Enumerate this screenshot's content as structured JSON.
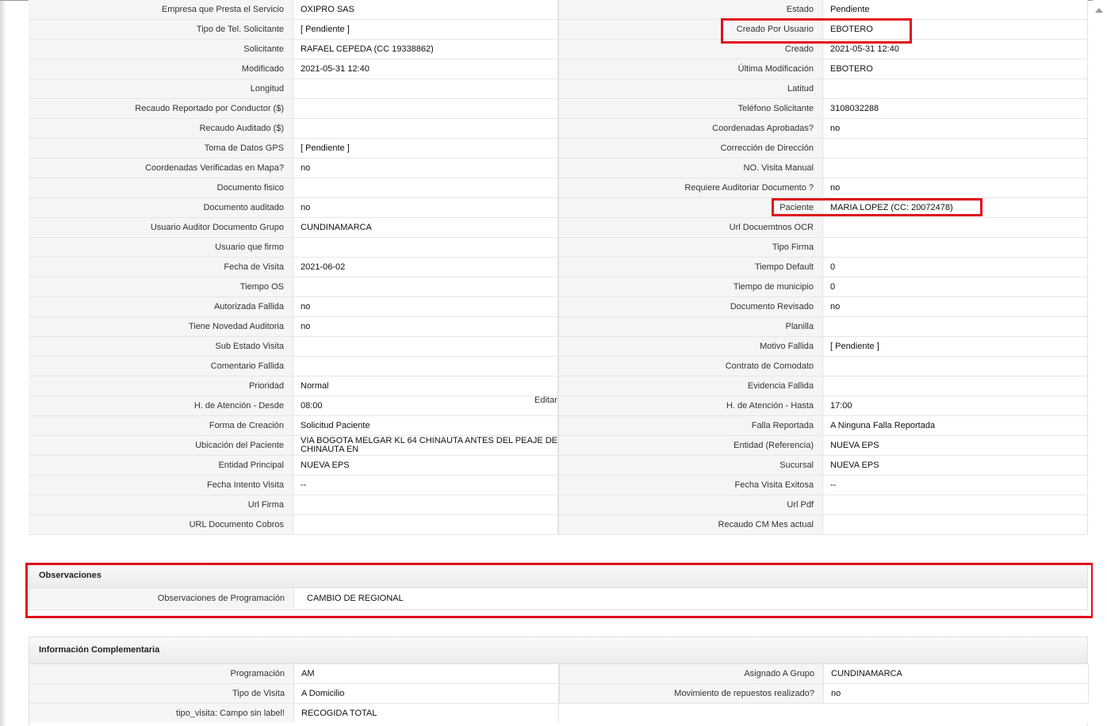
{
  "rows": [
    {
      "l1": "Empresa que Presta el Servicio",
      "v1": "OXIPRO SAS",
      "l2": "Estado",
      "v2": "Pendiente"
    },
    {
      "l1": "Tipo de Tel. Solicitante",
      "v1": "[ Pendiente ]",
      "l2": "Creado Por Usuario",
      "v2": "EBOTERO"
    },
    {
      "l1": "Solicitante",
      "v1": "RAFAEL CEPEDA (CC 19338862)",
      "l2": "Creado",
      "v2": "2021-05-31 12:40"
    },
    {
      "l1": "Modificado",
      "v1": "2021-05-31 12:40",
      "l2": "Última Modificación",
      "v2": " EBOTERO"
    },
    {
      "l1": "Longitud",
      "v1": "",
      "l2": "Latitud",
      "v2": ""
    },
    {
      "l1": "Recaudo Reportado por Conductor ($)",
      "v1": "",
      "l2": "Teléfono Solicitante",
      "v2": "3108032288"
    },
    {
      "l1": "Recaudo Auditado ($)",
      "v1": "",
      "l2": "Coordenadas Aprobadas?",
      "v2": " no"
    },
    {
      "l1": "Toma de Datos GPS",
      "v1": "[ Pendiente ]",
      "l2": "Corrección de Dirección",
      "v2": ""
    },
    {
      "l1": "Coordenadas Verificadas en Mapa?",
      "v1": " no",
      "l2": "NO. Visita Manual",
      "v2": ""
    },
    {
      "l1": "Documento fisico",
      "v1": "",
      "l2": "Requiere Auditoriar Documento ?",
      "v2": " no"
    },
    {
      "l1": "Documento auditado",
      "v1": " no",
      "l2": "Paciente",
      "v2": "MARIA LOPEZ (CC: 20072478)"
    },
    {
      "l1": "Usuario Auditor Documento Grupo",
      "v1": "CUNDINAMARCA",
      "l2": "Url Docuemtnos OCR",
      "v2": ""
    },
    {
      "l1": "Usuario que firmo",
      "v1": "",
      "l2": "Tipo Firma",
      "v2": ""
    },
    {
      "l1": "Fecha de Visita",
      "v1": " 2021-06-02",
      "l2": "Tiempo Default",
      "v2": " 0"
    },
    {
      "l1": "Tiempo OS",
      "v1": "",
      "l2": "Tiempo de municipio",
      "v2": " 0"
    },
    {
      "l1": "Autorizada Fallida",
      "v1": " no",
      "l2": "Documento Revisado",
      "v2": " no"
    },
    {
      "l1": "Tiene Novedad Auditoria",
      "v1": " no",
      "l2": "Planilla",
      "v2": ""
    },
    {
      "l1": "Sub Estado Visita",
      "v1": "",
      "l2": "Motivo Fallida",
      "v2": "[ Pendiente ]"
    },
    {
      "l1": "Comentario Fallida",
      "v1": "",
      "l2": "Contrato de Comodato",
      "v2": ""
    },
    {
      "l1": "Prioridad",
      "v1": "Normal",
      "l2": "Evidencia Fallida",
      "v2": ""
    },
    {
      "l1": "H. de Atención - Desde",
      "v1": "08:00",
      "l2": "H. de Atención - Hasta",
      "v2": "17:00"
    },
    {
      "l1": "Forma de Creación",
      "v1": "Solicitud Paciente",
      "l2": "Falla Reportada",
      "v2": "A Ninguna Falla Reportada"
    },
    {
      "l1": "Ubicación del Paciente",
      "v1": "VIA BOGOTA MELGAR KL 64 CHINAUTA ANTES DEL PEAJE DE CHINAUTA EN",
      "l2": "Entidad (Referencia)",
      "v2": "NUEVA EPS"
    },
    {
      "l1": "Entidad Principal",
      "v1": "NUEVA EPS",
      "l2": "Sucursal",
      "v2": "NUEVA EPS"
    },
    {
      "l1": "Fecha Intento Visita",
      "v1": " --",
      "l2": "Fecha Visita Exitosa",
      "v2": " --"
    },
    {
      "l1": "Url Firma",
      "v1": "",
      "l2": "Url Pdf",
      "v2": ""
    },
    {
      "l1": "URL Documento Cobros",
      "v1": "",
      "l2": "Recaudo CM Mes actual",
      "v2": ""
    }
  ],
  "editar_label": "Editar",
  "observaciones": {
    "title": "Observaciones",
    "label": "Observaciones de Programación",
    "value": "CAMBIO DE REGIONAL"
  },
  "complementaria": {
    "title": "Información Complementaria",
    "rows": [
      {
        "l1": "Programación",
        "v1": "AM",
        "l2": "Asignado A Grupo",
        "v2": "CUNDINAMARCA"
      },
      {
        "l1": "Tipo de Visita",
        "v1": "A Domicilio",
        "l2": "Movimiento de repuestos realizado?",
        "v2": " no"
      },
      {
        "l1": "tipo_visita: Campo sin label!",
        "v1": "RECOGIDA TOTAL",
        "l2": "",
        "v2": ""
      }
    ]
  },
  "colors": {
    "highlight": "#e0101c",
    "label_bg": "#f5f5f5",
    "border": "#e2e2e2"
  }
}
